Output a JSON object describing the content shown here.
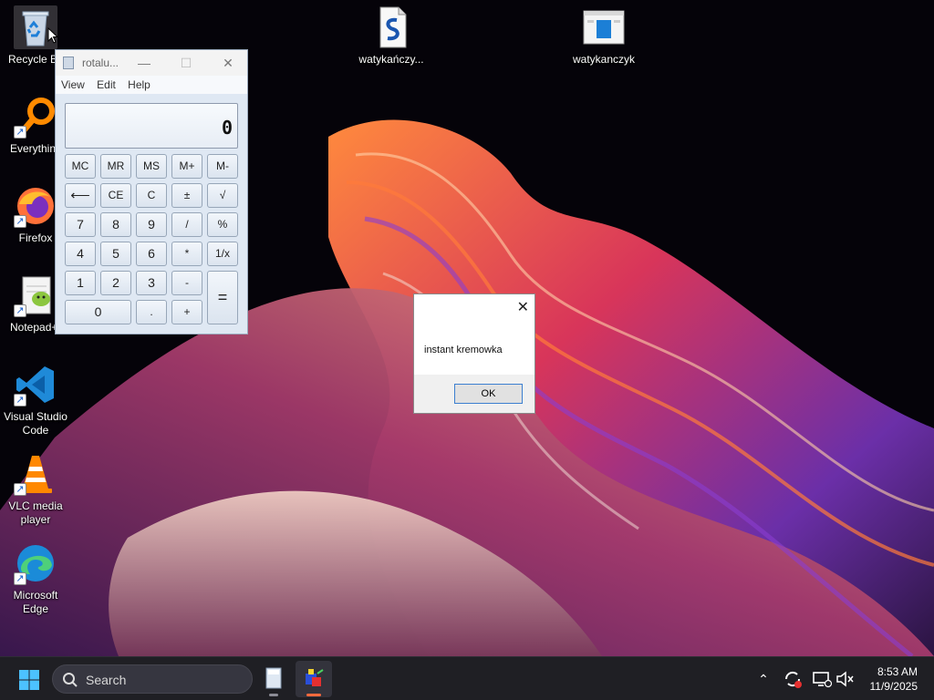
{
  "desktop": {
    "icons": [
      {
        "label": "Recycle Bin",
        "icon": "recycle-bin-icon"
      },
      {
        "label": "Everything",
        "icon": "everything-search-icon"
      },
      {
        "label": "Firefox",
        "icon": "firefox-icon"
      },
      {
        "label": "Notepad++",
        "icon": "notepad-plus-plus-icon"
      },
      {
        "label": "Visual Studio Code",
        "icon": "vscode-icon"
      },
      {
        "label": "VLC media player",
        "icon": "vlc-icon"
      },
      {
        "label": "Microsoft Edge",
        "icon": "edge-icon"
      },
      {
        "label": "watykańczy...",
        "icon": "script-file-icon"
      },
      {
        "label": "watykanczyk",
        "icon": "window-app-icon"
      }
    ]
  },
  "calculator": {
    "title": "rotalu...",
    "menu": [
      "View",
      "Edit",
      "Help"
    ],
    "display": "0",
    "buttons": {
      "mc": "MC",
      "mr": "MR",
      "ms": "MS",
      "mplus": "M+",
      "mminus": "M-",
      "back": "⟵",
      "ce": "CE",
      "c": "C",
      "plusminus": "±",
      "sqrt": "√",
      "n7": "7",
      "n8": "8",
      "n9": "9",
      "div": "/",
      "pct": "%",
      "n4": "4",
      "n5": "5",
      "n6": "6",
      "mul": "*",
      "recip": "1/x",
      "n1": "1",
      "n2": "2",
      "n3": "3",
      "sub": "-",
      "eq": "=",
      "n0": "0",
      "dot": ".",
      "add": "+"
    }
  },
  "messagebox": {
    "message": "instant kremowka",
    "ok_label": "OK"
  },
  "taskbar": {
    "search_label": "Search",
    "time": "8:53 AM",
    "date": "11/9/2025"
  },
  "colors": {
    "taskbar": "#1f1f24",
    "accent": "#ff6a3d",
    "calc_face": "#dfe8f3"
  }
}
